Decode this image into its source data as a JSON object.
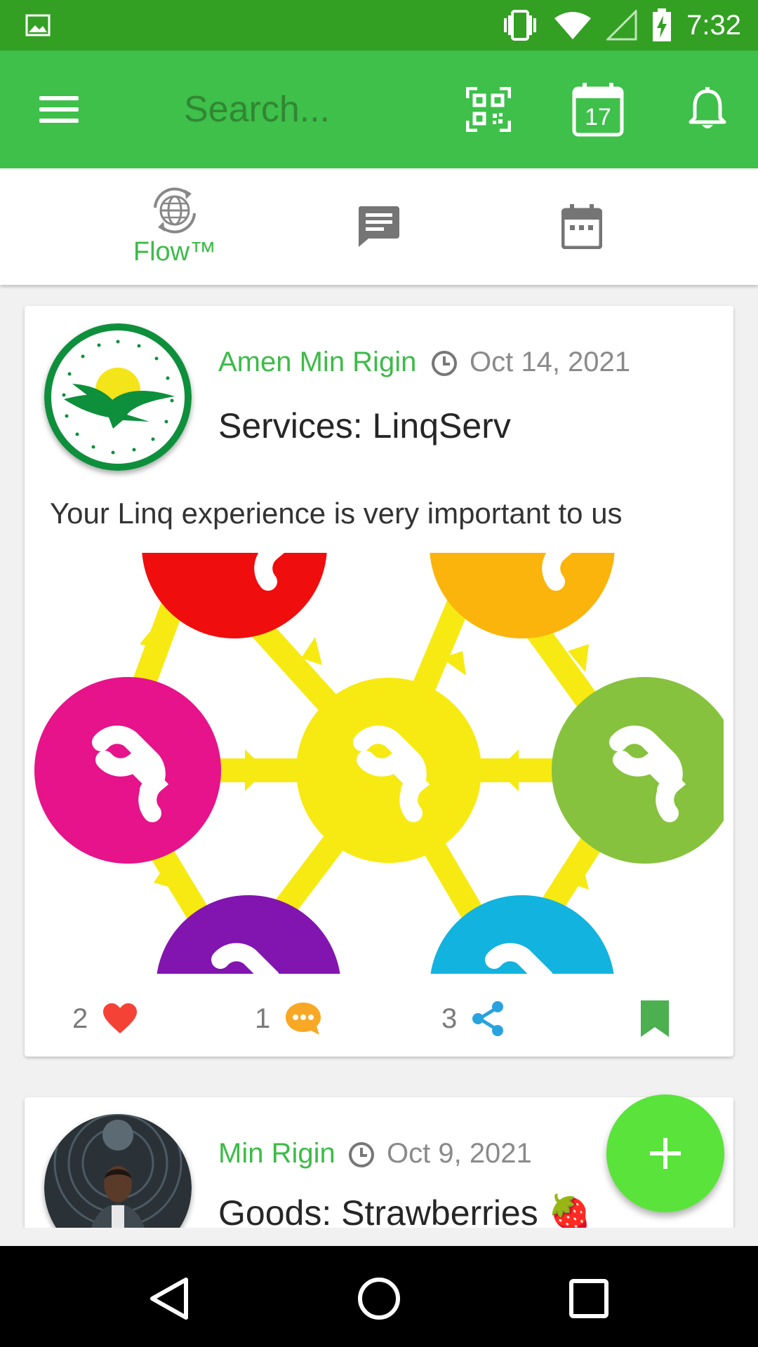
{
  "status_bar": {
    "time": "7:32",
    "icons": [
      "image-icon",
      "vibrate-icon",
      "wifi-icon",
      "signal-icon",
      "battery-charging-icon"
    ]
  },
  "app_bar": {
    "search_placeholder": "Search...",
    "calendar_day": "17",
    "icons": [
      "menu-icon",
      "qr-code-icon",
      "calendar-icon",
      "bell-icon"
    ]
  },
  "tabs": [
    {
      "label": "Flow™",
      "icon": "globe-sync-icon",
      "active": true
    },
    {
      "label": "",
      "icon": "chat-icon",
      "active": false
    },
    {
      "label": "",
      "icon": "calendar-icon",
      "active": false
    }
  ],
  "posts": [
    {
      "author": "Amen Min Rigin",
      "date": "Oct 14, 2021",
      "title": "Services: LinqServ",
      "body": "Your Linq experience is very important to us",
      "likes": "2",
      "comments": "1",
      "shares": "3",
      "avatar": "eagle-sun-logo"
    },
    {
      "author": "Min Rigin",
      "date": "Oct 9, 2021",
      "title": "Goods: Strawberries",
      "emoji": "🍓",
      "avatar": "person-photo"
    }
  ],
  "colors": {
    "status_bar": "#33a023",
    "app_bar": "#3ec04a",
    "accent": "#3dbb48",
    "fab": "#5ae33a",
    "like": "#f44336",
    "comment": "#f9a825",
    "share": "#29a3e0",
    "bookmark": "#4caf50"
  }
}
